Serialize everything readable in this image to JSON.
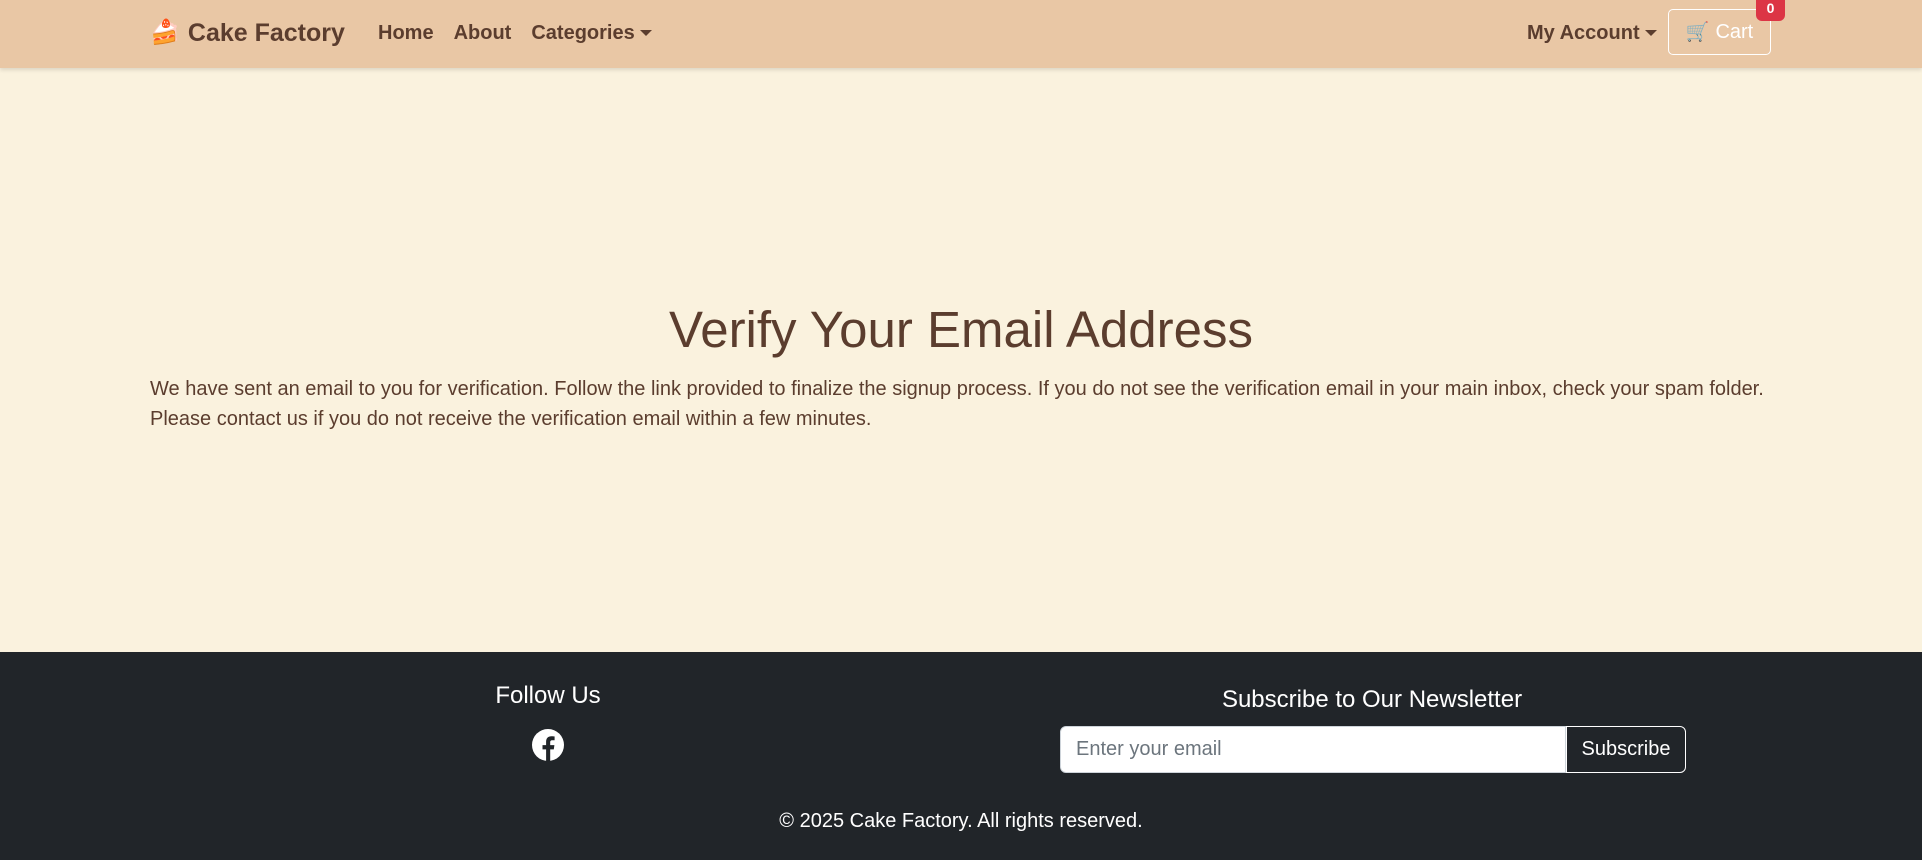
{
  "navbar": {
    "brand": {
      "icon": "🍰",
      "label": "Cake Factory"
    },
    "links": [
      {
        "label": "Home"
      },
      {
        "label": "About"
      },
      {
        "label": "Categories"
      }
    ],
    "account_label": "My Account",
    "cart": {
      "icon": "🛒",
      "label": "Cart",
      "count": "0"
    }
  },
  "main": {
    "title": "Verify Your Email Address",
    "body": "We have sent an email to you for verification. Follow the link provided to finalize the signup process. If you do not see the verification email in your main inbox, check your spam folder. Please contact us if you do not receive the verification email within a few minutes."
  },
  "footer": {
    "follow_title": "Follow Us",
    "newsletter_title": "Subscribe to Our Newsletter",
    "email_placeholder": "Enter your email",
    "subscribe_label": "Subscribe",
    "copyright": "© 2025 Cake Factory. All rights reserved."
  },
  "colors": {
    "navbar_bg": "#e9c7a5",
    "page_bg": "#faf2de",
    "text_brown": "#5b3d2e",
    "footer_bg": "#212529",
    "badge_red": "#dc3545"
  }
}
